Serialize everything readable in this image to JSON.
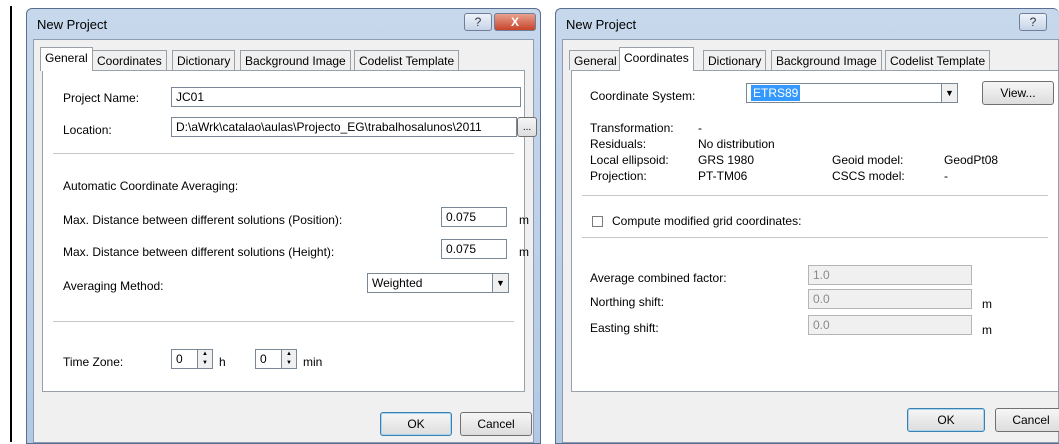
{
  "win1": {
    "title": "New Project",
    "help_glyph": "?",
    "close_glyph": "X",
    "tabs": [
      "General",
      "Coordinates",
      "Dictionary",
      "Background Image",
      "Codelist Template"
    ],
    "project_name_label": "Project Name:",
    "project_name_value": "JC01",
    "location_label": "Location:",
    "location_value": "D:\\aWrk\\catalao\\aulas\\Projecto_EG\\trabalhosalunos\\2011",
    "browse_label": "...",
    "averaging_header": "Automatic Coordinate Averaging:",
    "max_pos_label": "Max. Distance between different solutions (Position):",
    "max_pos_value": "0.075",
    "max_pos_unit": "m",
    "max_height_label": "Max. Distance between different solutions (Height):",
    "max_height_value": "0.075",
    "max_height_unit": "m",
    "averaging_method_label": "Averaging Method:",
    "averaging_method_value": "Weighted",
    "time_zone_label": "Time Zone:",
    "tz_hours_value": "0",
    "tz_hours_unit": "h",
    "tz_minutes_value": "0",
    "tz_minutes_unit": "min",
    "ok_label": "OK",
    "cancel_label": "Cancel"
  },
  "win2": {
    "title": "New Project",
    "help_glyph": "?",
    "tabs": [
      "General",
      "Coordinates",
      "Dictionary",
      "Background Image",
      "Codelist Template"
    ],
    "coord_system_label": "Coordinate System:",
    "coord_system_value": "ETRS89",
    "view_label": "View...",
    "transformation_label": "Transformation:",
    "transformation_value": "-",
    "residuals_label": "Residuals:",
    "residuals_value": "No distribution",
    "ellipsoid_label": "Local ellipsoid:",
    "ellipsoid_value": "GRS 1980",
    "geoid_label": "Geoid model:",
    "geoid_value": "GeodPt08",
    "projection_label": "Projection:",
    "projection_value": "PT-TM06",
    "cscs_label": "CSCS model:",
    "cscs_value": "-",
    "compute_label": "Compute modified grid coordinates:",
    "compute_checked": false,
    "avg_factor_label": "Average combined factor:",
    "avg_factor_value": "1.0",
    "northing_label": "Northing shift:",
    "northing_value": "0.0",
    "northing_unit": "m",
    "easting_label": "Easting shift:",
    "easting_value": "0.0",
    "easting_unit": "m",
    "ok_label": "OK",
    "cancel_label": "Cancel"
  },
  "icons": {
    "dropdown": "▼",
    "spin_up": "▲",
    "spin_down": "▼"
  }
}
